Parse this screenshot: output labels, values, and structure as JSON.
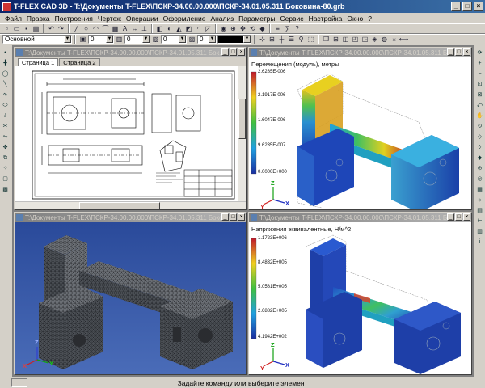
{
  "app": {
    "title": "T-FLEX CAD 3D - T:\\Документы T-FLEX\\ПСКР-34.00.00.000\\ПСКР-34.01.05.311 Боковина-80.grb"
  },
  "menu": [
    "Файл",
    "Правка",
    "Построения",
    "Чертеж",
    "Операции",
    "Оформление",
    "Анализ",
    "Параметры",
    "Сервис",
    "Настройка",
    "Окно",
    "?"
  ],
  "toolbar": {
    "layer_value": "Основной",
    "field1_value": "0",
    "field2_value": "0",
    "field3_value": "0",
    "field4_value": "0"
  },
  "windows": {
    "drawing": {
      "title": "T:\\Документы T-FLEX\\ПСКР-34.00.00.000\\ПСКР-34.01.05.311 Бок...",
      "tabs": [
        "Страница 1",
        "Страница 2"
      ],
      "active_tab": 0
    },
    "displacement": {
      "title": "T:\\Документы T-FLEX\\ПСКР-34.00.00.000\\ПСКР-34.01.05.311 Боковин...",
      "plot_label": "Перемещения (модуль), метры",
      "scale_values": [
        "2.6285E-006",
        "2.1917E-006",
        "1.6047E-006",
        "9.6235E-007",
        "0.0000E+000"
      ]
    },
    "mesh": {
      "title": "T:\\Документы T-FLEX\\ПСКР-34.00.00.000\\ПСКР-34.01.05.311 Боковина-80.grb"
    },
    "stress": {
      "title": "T:\\Документы T-FLEX\\ПСКР-34.00.00.000\\ПСКР-34.01.05.311 Боковин...",
      "plot_label": "Напряжения эквивалентные, Н/м^2",
      "scale_values": [
        "1.1723E+006",
        "8.4832E+005",
        "5.0581E+005",
        "2.6882E+005",
        "4.1942E+002"
      ]
    }
  },
  "axes": {
    "x": "X",
    "y": "Y",
    "z": "Z"
  },
  "status": {
    "text": "Задайте команду или выберите элемент"
  },
  "colors": {
    "titlebar": "#0a246a",
    "mesh_background": "#2a4a9a",
    "fea_blue": "#1e3fa8"
  }
}
